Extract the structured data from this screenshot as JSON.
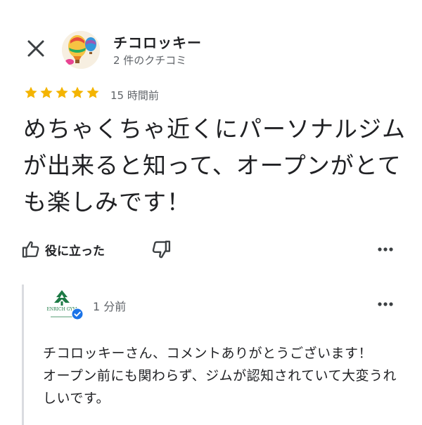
{
  "reviewer": {
    "name": "チコロッキー",
    "review_count": "2 件のクチコミ"
  },
  "review": {
    "rating": 5,
    "time": "15 時間前",
    "text": "めちゃくちゃ近くにパーソナルジムが出来ると知って、オープンがとても楽しみです！"
  },
  "actions": {
    "helpful_label": "役に立った"
  },
  "owner_reply": {
    "logo_text": "ENRICH GYM",
    "time": "1 分前",
    "paragraphs": [
      "チコロッキーさん、コメントありがとうございます！",
      "オープン前にも関わらず、ジムが認知されていて大変うれしいです。"
    ]
  },
  "colors": {
    "star": "#f4b400",
    "secondary_text": "#5f6368",
    "verified": "#1a73e8",
    "brand_green": "#1d7a45"
  },
  "icons": [
    "close-icon",
    "avatar-balloon-illustration",
    "star-icon",
    "thumbs-up-icon",
    "thumbs-down-icon",
    "more-horizontal-icon",
    "verified-check-icon",
    "tree-logo-icon"
  ]
}
